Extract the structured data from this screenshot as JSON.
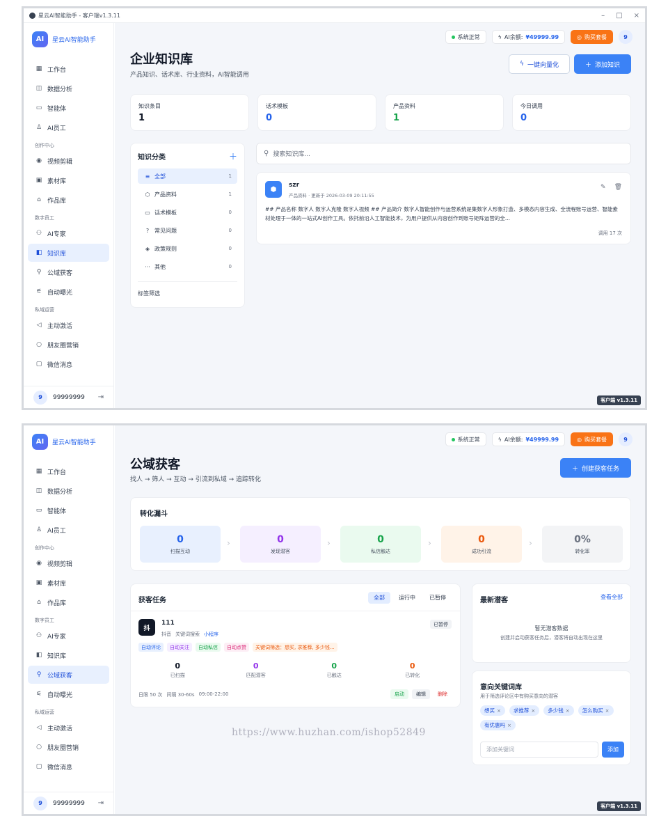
{
  "window": {
    "title": "星云AI智能助手 - 客户端v1.3.11"
  },
  "brand": {
    "logo": "AI",
    "name": "星云AI智能助手"
  },
  "nav": {
    "items_top": [
      {
        "label": "工作台",
        "icon": "grid-icon"
      },
      {
        "label": "数据分析",
        "icon": "chart-icon"
      },
      {
        "label": "智能体",
        "icon": "chat-icon"
      },
      {
        "label": "AI员工",
        "icon": "user-icon"
      }
    ],
    "section_create": "创作中心",
    "items_create": [
      {
        "label": "视频剪辑",
        "icon": "play-icon"
      },
      {
        "label": "素材库",
        "icon": "image-icon"
      },
      {
        "label": "作品库",
        "icon": "folder-icon"
      }
    ],
    "section_digital": "数字员工",
    "items_digital": [
      {
        "label": "AI专家",
        "icon": "team-icon"
      },
      {
        "label": "知识库",
        "icon": "book-icon"
      },
      {
        "label": "公域获客",
        "icon": "search-icon"
      },
      {
        "label": "自动曝光",
        "icon": "broadcast-icon"
      }
    ],
    "section_private": "私域运营",
    "items_private": [
      {
        "label": "主动激活",
        "icon": "megaphone-icon"
      },
      {
        "label": "朋友圈营销",
        "icon": "moments-icon"
      },
      {
        "label": "微信消息",
        "icon": "message-icon"
      }
    ]
  },
  "user": {
    "avatar": "9",
    "name": "99999999"
  },
  "topbar": {
    "status": "系统正常",
    "balance_label": "AI余额:",
    "balance": "¥49999.99",
    "buy": "购买套餐",
    "avatar": "9"
  },
  "version": "客户端 v1.3.11",
  "kb": {
    "title": "企业知识库",
    "subtitle": "产品知识、话术库、行业资料，AI智能调用",
    "btn_vectorize": "一键向量化",
    "btn_add": "添加知识",
    "stats": [
      {
        "label": "知识条目",
        "value": "1",
        "color": "#111827"
      },
      {
        "label": "话术模板",
        "value": "0",
        "color": "#2563eb"
      },
      {
        "label": "产品资料",
        "value": "1",
        "color": "#16a34a"
      },
      {
        "label": "今日调用",
        "value": "0",
        "color": "#2563eb"
      }
    ],
    "categories_title": "知识分类",
    "categories": [
      {
        "label": "全部",
        "count": "1",
        "icon": "list-icon"
      },
      {
        "label": "产品资料",
        "count": "1",
        "icon": "box-icon"
      },
      {
        "label": "话术模板",
        "count": "0",
        "icon": "chat-icon"
      },
      {
        "label": "常见问题",
        "count": "0",
        "icon": "question-icon"
      },
      {
        "label": "政策规则",
        "count": "0",
        "icon": "shield-icon"
      },
      {
        "label": "其他",
        "count": "0",
        "icon": "more-icon"
      }
    ],
    "tag_filter": "标签筛选",
    "search_placeholder": "搜索知识库...",
    "item": {
      "title": "szr",
      "meta": "产品资料 · 更新于 2026-03-09 20:11:55",
      "body": "## 产品名称 数字人 数字人克隆 数字人视频 ## 产品简介 数字人智能创作与运营系统是集数字人形象打造、多模态内容生成、全流程账号运营、智能素材处理于一体的一站式AI创作工具。依托前沿人工智能技术，为用户提供从内容创作到账号矩阵运营的全...",
      "usage": "调用 17 次"
    }
  },
  "acq": {
    "title": "公域获客",
    "subtitle": "找人 → 筛人 → 互动 → 引流到私域 → 追踪转化",
    "btn_create": "创建获客任务",
    "funnel_title": "转化漏斗",
    "funnel": [
      {
        "label": "扫描互动",
        "value": "0",
        "color": "#2563eb",
        "bg": "#e8f0fe"
      },
      {
        "label": "发现潜客",
        "value": "0",
        "color": "#9333ea",
        "bg": "#f5efff"
      },
      {
        "label": "私信触达",
        "value": "0",
        "color": "#16a34a",
        "bg": "#eafaef"
      },
      {
        "label": "成功引流",
        "value": "0",
        "color": "#ea580c",
        "bg": "#fff3e8"
      },
      {
        "label": "转化率",
        "value": "0%",
        "color": "#6b7280",
        "bg": "#f3f4f6"
      }
    ],
    "tasks_title": "获客任务",
    "tabs": [
      "全部",
      "运行中",
      "已暂停"
    ],
    "task": {
      "icon": "抖",
      "name": "111",
      "platform": "抖音",
      "mode": "关键词搜索",
      "type": "小程序",
      "status": "已暂停",
      "tags": [
        {
          "label": "自动评论",
          "color": "#2563eb",
          "bg": "#e8f0fe"
        },
        {
          "label": "自动关注",
          "color": "#9333ea",
          "bg": "#f5efff"
        },
        {
          "label": "自动私信",
          "color": "#16a34a",
          "bg": "#eafaef"
        },
        {
          "label": "自动点赞",
          "color": "#db2777",
          "bg": "#fdeef5"
        },
        {
          "label": "关键词筛选：想买, 求推荐, 多少钱...",
          "color": "#ea580c",
          "bg": "#fff3e8"
        }
      ],
      "stats": [
        {
          "label": "已扫描",
          "value": "0",
          "color": "#111827"
        },
        {
          "label": "匹配潜客",
          "value": "0",
          "color": "#9333ea"
        },
        {
          "label": "已触达",
          "value": "0",
          "color": "#16a34a"
        },
        {
          "label": "已转化",
          "value": "0",
          "color": "#ea580c"
        }
      ],
      "limit": "日限 50 次",
      "interval": "间隔 30-60s",
      "hours": "09:00-22:00",
      "actions": [
        {
          "label": "启动",
          "color": "#16a34a",
          "bg": "#eafaef"
        },
        {
          "label": "编辑",
          "color": "#374151",
          "bg": "#f1f3f6"
        },
        {
          "label": "删除",
          "color": "#dc2626",
          "bg": "#fff"
        }
      ]
    },
    "leads_title": "最新潜客",
    "leads_link": "查看全部",
    "leads_empty": "暂无潜客数据",
    "leads_hint": "创建并启动获客任务后，潜客将自动出现在这里",
    "kw_title": "意向关键词库",
    "kw_sub": "用于筛选评论区中有购买意向的潜客",
    "keywords": [
      "想买",
      "求推荐",
      "多少钱",
      "怎么购买",
      "有优惠吗"
    ],
    "kw_placeholder": "添加关键词",
    "kw_add": "添加"
  },
  "watermark": "https://www.huzhan.com/ishop52849"
}
